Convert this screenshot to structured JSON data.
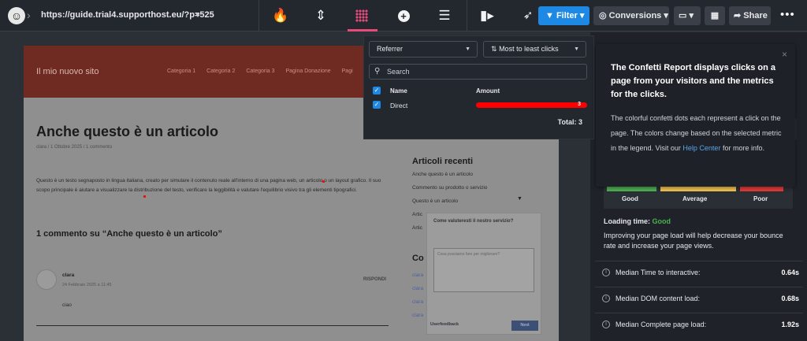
{
  "topbar": {
    "url": "https://guide.trial4.supporthost.eu/?p=525",
    "modes": [
      "heatmap-flame-icon",
      "scrollmap-icon",
      "confetti-icon",
      "overlay-icon",
      "list-icon",
      "recordings-icon",
      "click-cursor-icon"
    ],
    "active_mode": "confetti-icon",
    "filter_label": "Filter",
    "conversions_label": "Conversions",
    "share_label": "Share",
    "accent": "#e84a79",
    "primary": "#1e88e5"
  },
  "site": {
    "title": "Il mio nuovo sito",
    "nav": [
      "Categoria 1",
      "Categoria 2",
      "Categoria 3",
      "Pagina Donazione",
      "Pagi"
    ],
    "article_title": "Anche questo è un articolo",
    "meta": "clara  /  1 Ottobre 2025  /  1 commento",
    "body": "Questo è un testo segnaposto in lingua italiana, creato per simulare il contenuto reale all'interno di una pagina web, un articolo o un layout grafico. Il suo scopo principale è aiutare a visualizzare la distribuzione del testo, verificare la leggibilità e valutare l'equilibrio visivo tra gli elementi tipografici.",
    "comments_title": "1 commento su “Anche questo è un articolo”",
    "comment_author": "clara",
    "comment_date": "24 Febbraio 2025 a 11:45",
    "reply_label": "RISPONDI",
    "comment_text": "ciao",
    "sidebar_title": "Articoli recenti",
    "sidebar_items": [
      "Anche questo è un articolo",
      "Commento su prodotto o servizio",
      "Questo è un articolo",
      "Artic",
      "Artic"
    ],
    "sidebar_title2": "Co",
    "sidebar_items2": [
      "clara",
      "clara",
      "clara",
      "clara"
    ],
    "feedback_question": "Come valuteresti il nostro servizio?",
    "feedback_placeholder": "Cosa possiamo fare per migliorare?",
    "feedback_brand": "Userfeedback",
    "feedback_next": "Next"
  },
  "filter_popup": {
    "referrer_label": "Referrer",
    "sort_label": "Most to least clicks",
    "search_placeholder": "Search",
    "col_name": "Name",
    "col_amount": "Amount",
    "rows": [
      {
        "name": "Direct",
        "amount": "3",
        "share": 1.0
      }
    ],
    "total_label": "Total:",
    "total_value": "3",
    "bar_color": "#ff0000"
  },
  "tooltip": {
    "heading": "The Confetti Report displays clicks on a page from your visitors and the metrics for the clicks.",
    "body_1": "The colorful confetti dots each represent a click on the page. The colors change based on the selected metric in the legend. Visit our ",
    "link": "Help Center",
    "body_2": " for more info.",
    "close": "×"
  },
  "performance": {
    "scale_labels": [
      "Good",
      "Average",
      "Poor"
    ],
    "scale_colors": [
      "#4caf50",
      "#f2c14e",
      "#e53935"
    ],
    "loading_label": "Loading time:",
    "loading_value": "Good",
    "loading_desc": "Improving your page load will help decrease your bounce rate and increase your page views.",
    "metrics": [
      {
        "label": "Median Time to interactive:",
        "value": "0.64s"
      },
      {
        "label": "Median DOM content load:",
        "value": "0.68s"
      },
      {
        "label": "Median Complete page load:",
        "value": "1.92s"
      }
    ]
  }
}
